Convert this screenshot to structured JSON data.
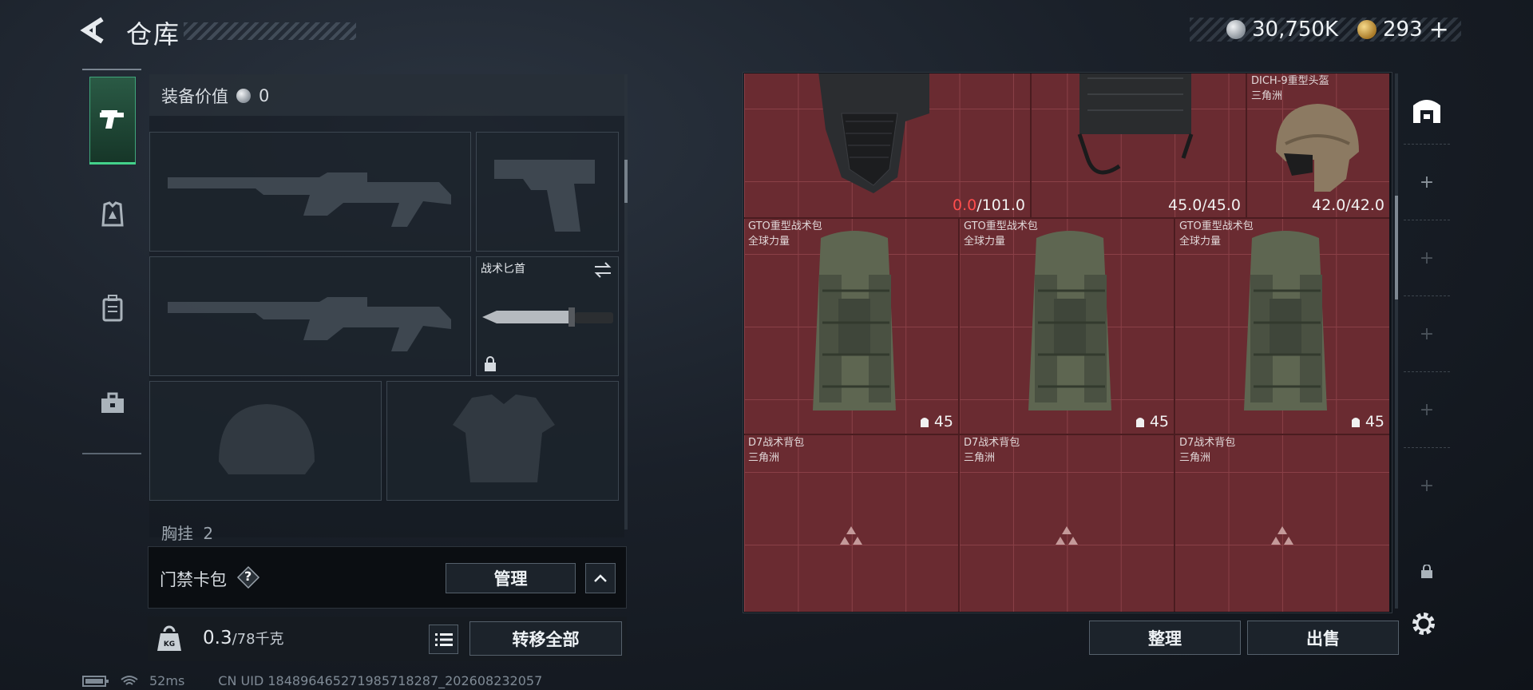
{
  "header": {
    "title": "仓库",
    "currency_silver": "30,750K",
    "currency_gold": "293",
    "currency_gold_plus": "+"
  },
  "equipment": {
    "value_label": "装备价值",
    "value": "0",
    "knife_slot_label": "战术匕首",
    "chest_label": "胸挂",
    "chest_count": "2"
  },
  "cardbag": {
    "label": "门禁卡包",
    "help": "?",
    "manage_button": "管理"
  },
  "weight": {
    "current": "0.3",
    "max": "/78千克",
    "transfer_button": "转移全部"
  },
  "status": {
    "ping": "52ms",
    "uid": "CN UID 1848964652719857182​87_202608232057"
  },
  "storage": {
    "items": [
      {
        "name": "",
        "sub": "",
        "dur_cur": "0.0",
        "dur_max": "/101.0"
      },
      {
        "name": "",
        "sub": "",
        "dur": "45.0/45.0"
      },
      {
        "name": "DICH-9重型头盔",
        "sub": "三角洲",
        "dur": "42.0/42.0"
      },
      {
        "name": "GTO重型战术包",
        "sub": "全球力量",
        "cap": "45"
      },
      {
        "name": "GTO重型战术包",
        "sub": "全球力量",
        "cap": "45"
      },
      {
        "name": "GTO重型战术包",
        "sub": "全球力量",
        "cap": "45"
      },
      {
        "name": "D7战术背包",
        "sub": "三角洲"
      },
      {
        "name": "D7战术背包",
        "sub": "三角洲"
      },
      {
        "name": "D7战术背包",
        "sub": "三角洲"
      }
    ],
    "organize_button": "整理",
    "sell_button": "出售"
  },
  "colors": {
    "grid_bg": "#6a2b31",
    "grid_line": "#8a4047",
    "active_tab": "#43d28b",
    "red_value": "#ff4d4d"
  },
  "icons": [
    "back-icon",
    "pistol-icon",
    "armor-icon",
    "backpack-icon",
    "toolbox-icon",
    "kg-weight-icon",
    "list-icon",
    "chevron-up-icon",
    "lock-icon",
    "swap-icon",
    "silver-coin-icon",
    "gold-coin-icon",
    "helmet-icon",
    "settings-icon",
    "plus-icon",
    "triangle-logo-icon",
    "wifi-icon",
    "battery-icon"
  ]
}
